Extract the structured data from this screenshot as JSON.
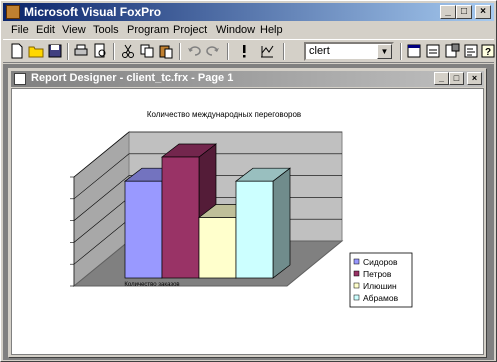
{
  "app": {
    "title": "Microsoft Visual FoxPro"
  },
  "menu": [
    "File",
    "Edit",
    "View",
    "Tools",
    "Program",
    "Project",
    "Window",
    "Help"
  ],
  "toolbar": {
    "combo_value": "clert"
  },
  "child": {
    "title": "Report Designer - client_tc.frx - Page 1"
  },
  "chart_data": {
    "type": "bar",
    "title": "Количество международных переговоров",
    "xlabel": "Количество заказов",
    "series": [
      {
        "name": "Сидоров",
        "values": [
          4
        ]
      },
      {
        "name": "Петров",
        "values": [
          5
        ]
      },
      {
        "name": "Илюшин",
        "values": [
          2.5
        ]
      },
      {
        "name": "Абрамов",
        "values": [
          4
        ]
      }
    ],
    "colors": [
      "#9999ff",
      "#993366",
      "#ffffcc",
      "#ccffff"
    ],
    "ylim": [
      0,
      5
    ],
    "grid": true,
    "legend_position": "right"
  }
}
